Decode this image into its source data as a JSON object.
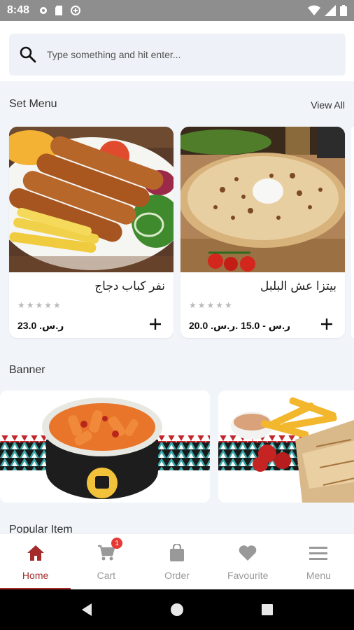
{
  "status_bar": {
    "time": "8:48"
  },
  "search": {
    "placeholder": "Type something and hit enter..."
  },
  "set_menu": {
    "title": "Set Menu",
    "view_all": "View All",
    "items": [
      {
        "name": "نفر كباب دجاج",
        "price": "23.0 .ر.س",
        "rating": 0
      },
      {
        "name": "بيتزا عش البلبل",
        "price": "20.0 .ر.س - 15.0 .ر.س",
        "rating": 0
      }
    ]
  },
  "banner": {
    "title": "Banner"
  },
  "popular": {
    "title": "Popular Item"
  },
  "bottom_nav": {
    "items": [
      {
        "label": "Home",
        "icon": "home-icon"
      },
      {
        "label": "Cart",
        "icon": "cart-icon",
        "badge": "1"
      },
      {
        "label": "Order",
        "icon": "bag-icon"
      },
      {
        "label": "Favourite",
        "icon": "heart-icon"
      },
      {
        "label": "Menu",
        "icon": "menu-icon"
      }
    ]
  },
  "colors": {
    "accent": "#a52a2a",
    "badge": "#e53935",
    "background": "#f1f4f9"
  }
}
